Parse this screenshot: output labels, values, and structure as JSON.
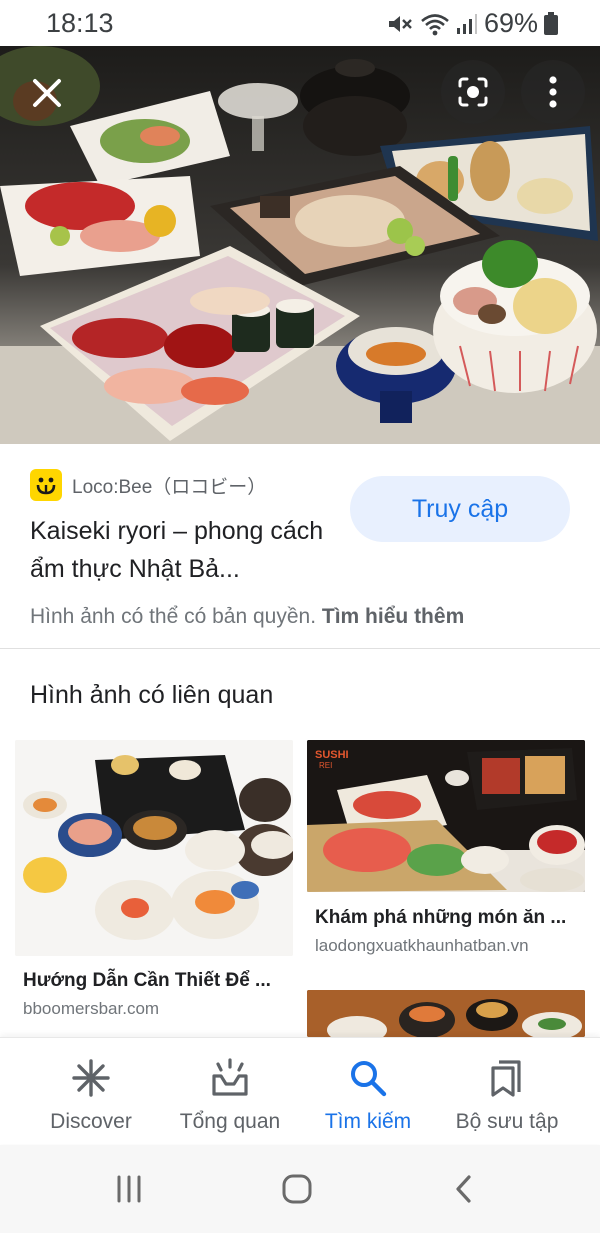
{
  "status_bar": {
    "time": "18:13",
    "battery_percent": "69%"
  },
  "hero": {
    "icons": [
      "close-icon",
      "lens-icon",
      "more-vert-icon"
    ]
  },
  "result": {
    "source_name": "Loco:Bee（ロコビー）",
    "title": "Kaiseki ryori – phong cách ẩm thực Nhật Bả...",
    "visit_label": "Truy cập",
    "copyright_text": "Hình ảnh có thể có bản quyền.",
    "learn_more": "Tìm hiểu thêm"
  },
  "related": {
    "title": "Hình ảnh có liên quan",
    "items": [
      {
        "title": "Hướng Dẫn Cần Thiết Để ...",
        "domain": "bboomersbar.com"
      },
      {
        "title": "Khám phá những món ăn ...",
        "domain": "laodongxuatkhaunhatban.vn",
        "logo_text": "SUSHI REI"
      },
      {
        "title": "",
        "domain": ""
      }
    ]
  },
  "bottom_nav": {
    "items": [
      {
        "label": "Discover",
        "icon": "asterisk-icon",
        "active": false
      },
      {
        "label": "Tổng quan",
        "icon": "updates-icon",
        "active": false
      },
      {
        "label": "Tìm kiếm",
        "icon": "search-icon",
        "active": true
      },
      {
        "label": "Bộ sưu tập",
        "icon": "collections-icon",
        "active": false
      }
    ]
  },
  "colors": {
    "accent": "#1a73e8",
    "visit_button_bg": "#e8f0fe",
    "favicon": "#ffd600",
    "text_secondary": "#5f6368"
  }
}
